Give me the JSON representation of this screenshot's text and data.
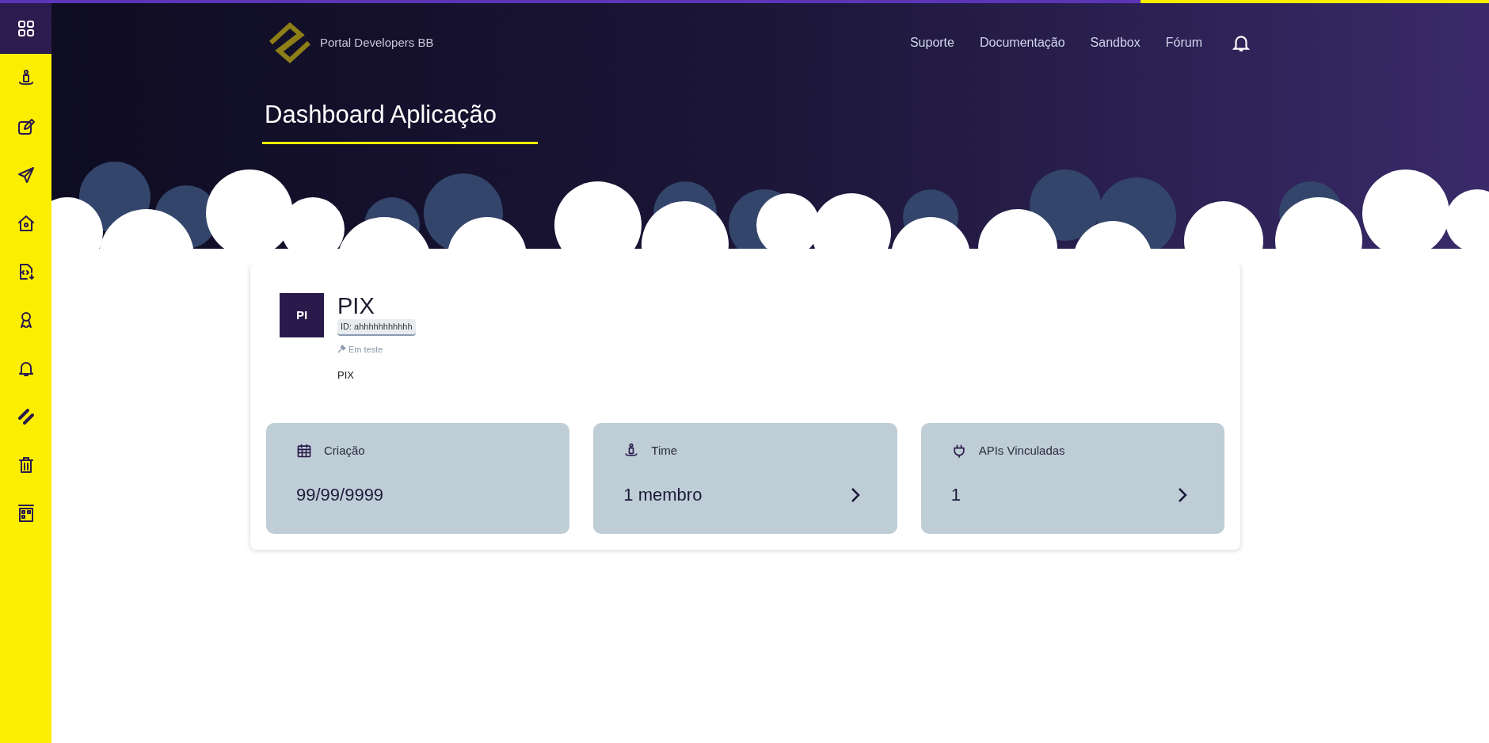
{
  "sidebar": {
    "items": [
      {
        "selected": true
      },
      {
        "selected": false
      },
      {
        "selected": false
      },
      {
        "selected": false
      },
      {
        "selected": false
      },
      {
        "selected": false
      },
      {
        "selected": false
      },
      {
        "selected": false
      },
      {
        "selected": false
      },
      {
        "selected": false
      },
      {
        "selected": false
      }
    ]
  },
  "header": {
    "brand": "Portal Developers BB",
    "nav": [
      "Suporte",
      "Documentação",
      "Sandbox",
      "Fórum"
    ],
    "title": "Dashboard Aplicação"
  },
  "app": {
    "initials": "PI",
    "name": "PIX",
    "id": "ID: ahhhhhhhhhhh",
    "status": "Em teste",
    "description": "PIX"
  },
  "stats": [
    {
      "label": "Criação",
      "value": "99/99/9999",
      "link": false
    },
    {
      "label": "Time",
      "value": "1 membro",
      "link": true
    },
    {
      "label": "APIs Vinculadas",
      "value": "1",
      "link": true
    }
  ]
}
